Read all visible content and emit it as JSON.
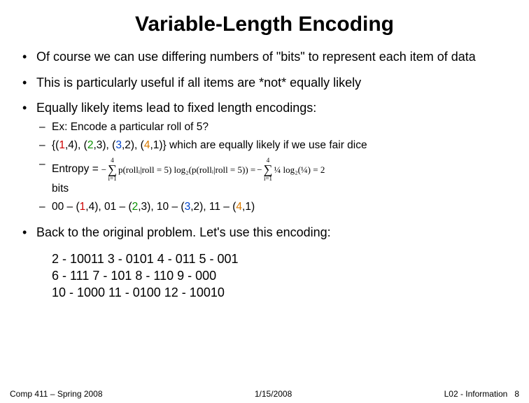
{
  "title": "Variable-Length Encoding",
  "bullets": {
    "b1": "Of course we can use differing numbers of \"bits\" to represent each item of data",
    "b2": "This is particularly useful if all items are *not* equally likely",
    "b3": "Equally likely items lead to fixed length encodings:",
    "b4": "Back to the original problem. Let's use this encoding:"
  },
  "sub": {
    "s1": "Ex: Encode a particular roll of 5?",
    "s2_pre": "{(",
    "s2_r1": "1",
    "s2_m1": ",4), (",
    "s2_r2": "2",
    "s2_m2": ",3), (",
    "s2_r3": "3",
    "s2_m3": ",2), (",
    "s2_r4": "4",
    "s2_m4": ",1)} which are equally likely if we use fair dice",
    "s3_label": "Entropy =",
    "s3_bits": "bits",
    "s4_pre": "00 – (",
    "s4_r1": "1",
    "s4_m1": ",4),  01 – (",
    "s4_r2": "2",
    "s4_m2": ",3),  10 – (",
    "s4_r3": "3",
    "s4_m3": ",2),  11 – (",
    "s4_r4": "4",
    "s4_m4": ",1)"
  },
  "formula": {
    "minus1": "−",
    "sup": "4",
    "sub": "i=1",
    "body1": "p(rollᵢ|roll = 5) log₂(p(rollᵢ|roll = 5)) = ",
    "minus2": "−",
    "frac": "¼ log₂(¼) = 2",
    "result": ""
  },
  "encoding": {
    "r1": "2 - 10011    3 - 0101     4 - 011 5 - 001",
    "r2": "6 - 111 7 - 101 8 - 110 9 - 000",
    "r3": "10 - 1000     11 - 0100     12 - 10010"
  },
  "footer": {
    "left": "Comp 411 – Spring 2008",
    "center": "1/15/2008",
    "right": "L02 - Information",
    "page": "8"
  }
}
